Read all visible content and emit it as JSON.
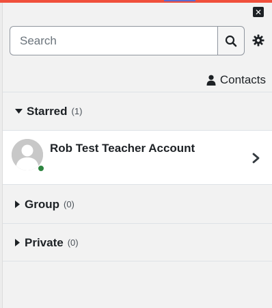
{
  "search": {
    "placeholder": "Search"
  },
  "header": {
    "contacts_label": "Contacts"
  },
  "sections": [
    {
      "label": "Starred",
      "count": "(1)",
      "expanded": true
    },
    {
      "label": "Group",
      "count": "(0)",
      "expanded": false
    },
    {
      "label": "Private",
      "count": "(0)",
      "expanded": false
    }
  ],
  "starred_contacts": [
    {
      "name": "Rob Test Teacher Account",
      "status": "online"
    }
  ],
  "colors": {
    "accent_bar": "#f0503c",
    "online": "#2e8540"
  },
  "icons": {
    "close": "close-icon",
    "search": "search-icon",
    "settings": "gear-icon",
    "contacts": "user-icon",
    "expanded": "caret-down-icon",
    "collapsed": "caret-right-icon",
    "open_conversation": "chevron-right-icon"
  }
}
